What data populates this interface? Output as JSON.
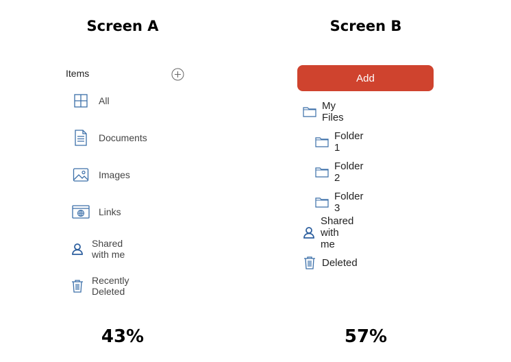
{
  "titles": {
    "screen_a": "Screen A",
    "screen_b": "Screen B"
  },
  "results": {
    "screen_a": "43%",
    "screen_b": "57%"
  },
  "screen_a": {
    "header": "Items",
    "items": [
      {
        "label": "All",
        "icon": "grid-icon"
      },
      {
        "label": "Documents",
        "icon": "document-icon"
      },
      {
        "label": "Images",
        "icon": "image-icon"
      },
      {
        "label": "Links",
        "icon": "link-icon"
      },
      {
        "label": "Shared with me",
        "icon": "person-icon"
      },
      {
        "label": "Recently Deleted",
        "icon": "trash-icon"
      }
    ]
  },
  "screen_b": {
    "add_label": "Add",
    "items": [
      {
        "label": "My Files",
        "icon": "folder-icon"
      },
      {
        "label": "Folder 1",
        "icon": "folder-icon"
      },
      {
        "label": "Folder 2",
        "icon": "folder-icon"
      },
      {
        "label": "Folder 3",
        "icon": "folder-icon"
      },
      {
        "label": "Shared with me",
        "icon": "person-icon"
      },
      {
        "label": "Deleted",
        "icon": "trash-icon"
      }
    ]
  },
  "colors": {
    "accent": "#cf432e",
    "icon": "#3a6ea8"
  }
}
